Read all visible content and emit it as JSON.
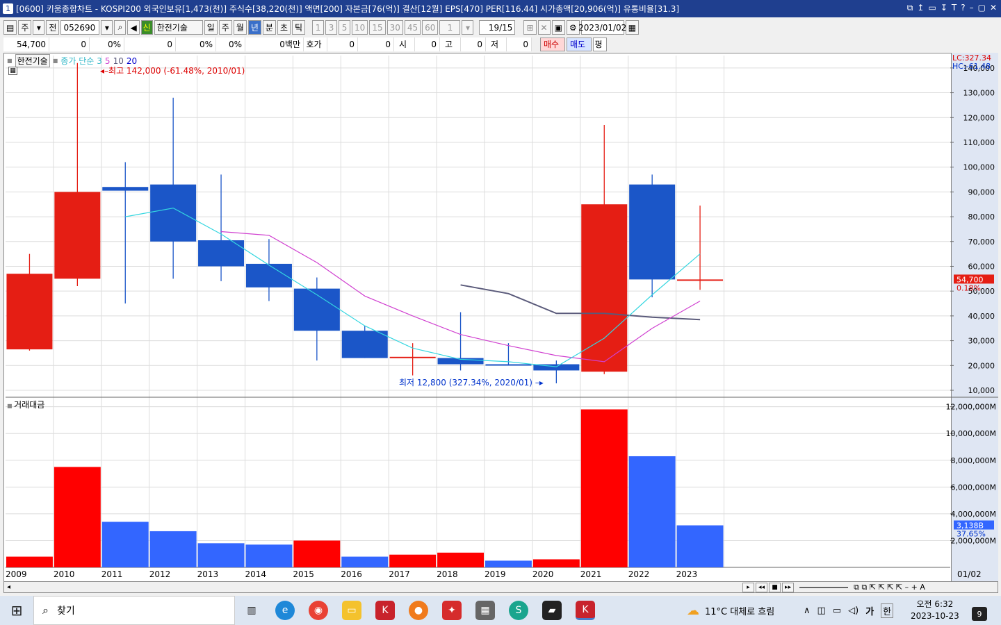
{
  "window": {
    "number": "1",
    "title": "[0600] 키움종합차트 - KOSPI200 외국인보유[1,473(천)] 주식수[38,220(천)] 액면[200] 자본금[76(억)] 결산[12월] EPS[470] PER[116.44] 시가총액[20,906(억)] 유통비율[31.3]",
    "controls": [
      "⧉",
      "↥",
      "▭",
      "↧",
      "T",
      "?",
      "–",
      "▢",
      "✕"
    ]
  },
  "toolbar": {
    "market": "주",
    "whole": "전",
    "code": "052690",
    "stock_name": "한전기술",
    "stock_badge": "신",
    "periods": [
      "일",
      "주",
      "월",
      "년",
      "분",
      "초",
      "틱"
    ],
    "selected_period": "년",
    "intervals": [
      "1",
      "3",
      "5",
      "10",
      "15",
      "30",
      "45",
      "60"
    ],
    "count": "1",
    "page": "19/15",
    "date": "2023/01/02"
  },
  "infobar": {
    "price": "54,700",
    "change": "0",
    "change_pct": "0%",
    "volume": "0",
    "volume_pct": "0%",
    "amount": "0%",
    "unit": "0백만",
    "quote_label": "호가",
    "quote_v1": "0",
    "quote_v2": "0",
    "open_label": "시",
    "open_v": "0",
    "high_label": "고",
    "high_v": "0",
    "low_label": "저",
    "low_v": "0",
    "buy": "매수",
    "sell": "매도",
    "eval": "평"
  },
  "price_panel": {
    "stock_label": "한전기술",
    "ma_label": "종가 단순",
    "ma_periods": [
      "3",
      "5",
      "10",
      "20"
    ],
    "high_annotation": "최고 142,000 (-61.48%, 2010/01)",
    "low_annotation": "최저 12,800 (327.34%, 2020/01)",
    "lc": "LC:327.34",
    "hc": "HC:-61.48",
    "current_price_tag": "54,700",
    "current_pct_tag": "0.18%",
    "y_ticks": [
      "140,000",
      "130,000",
      "120,000",
      "110,000",
      "100,000",
      "90,000",
      "80,000",
      "70,000",
      "60,000",
      "50,000",
      "40,000",
      "30,000",
      "20,000",
      "10,000"
    ]
  },
  "volume_panel": {
    "label": "거래대금",
    "current_tag": "3,138B",
    "current_pct": "37.65%",
    "y_ticks": [
      "12,000,000M",
      "10,000,000M",
      "8,000,000M",
      "6,000,000M",
      "4,000,000M",
      "2,000,000M"
    ]
  },
  "x_axis": {
    "labels": [
      "2009",
      "2010",
      "2011",
      "2012",
      "2013",
      "2014",
      "2015",
      "2016",
      "2017",
      "2018",
      "2019",
      "2020",
      "2021",
      "2022",
      "2023"
    ],
    "right_label": "01/02"
  },
  "colors": {
    "up": "#e51e14",
    "down": "#1b56c8",
    "vol_up": "#ff0000",
    "vol_down": "#3366ff",
    "ma3": "#33d6e0",
    "ma5": "#d040d0",
    "ma10": "#5a5a7a"
  },
  "chart_data": [
    {
      "type": "candlestick",
      "title": "한전기술",
      "x": [
        "2009",
        "2010",
        "2011",
        "2012",
        "2013",
        "2014",
        "2015",
        "2016",
        "2017",
        "2018",
        "2019",
        "2020",
        "2021",
        "2022",
        "2023"
      ],
      "ohlc": [
        [
          26500,
          65000,
          26000,
          57000
        ],
        [
          55000,
          142000,
          52000,
          90000
        ],
        [
          92000,
          102000,
          45000,
          90500
        ],
        [
          93000,
          128000,
          55000,
          70000
        ],
        [
          70500,
          97000,
          54000,
          60000
        ],
        [
          61000,
          71000,
          46000,
          51500
        ],
        [
          51000,
          55500,
          22000,
          34000
        ],
        [
          34000,
          36000,
          23000,
          23000
        ],
        [
          23500,
          29000,
          16000,
          23500
        ],
        [
          23000,
          41500,
          18000,
          20500
        ],
        [
          20500,
          29000,
          20000,
          20000
        ],
        [
          20500,
          22000,
          12800,
          18000
        ],
        [
          17500,
          117000,
          16500,
          85000
        ],
        [
          93000,
          97000,
          47500,
          54700
        ],
        [
          54700,
          84500,
          50500,
          54700
        ]
      ],
      "ma3": [
        null,
        null,
        80000,
        83500,
        73000,
        60500,
        48500,
        36000,
        27000,
        22500,
        21500,
        19500,
        31000,
        48500,
        65000
      ],
      "ma5": [
        null,
        null,
        null,
        null,
        74000,
        72500,
        61500,
        48000,
        40000,
        32500,
        28000,
        24000,
        21500,
        35000,
        46000
      ],
      "ma10": [
        null,
        null,
        null,
        null,
        null,
        null,
        null,
        null,
        null,
        52500,
        49000,
        41000,
        41000,
        39500,
        38500
      ],
      "ylim": [
        10000,
        145000
      ]
    },
    {
      "type": "bar",
      "title": "거래대금",
      "x": [
        "2009",
        "2010",
        "2011",
        "2012",
        "2013",
        "2014",
        "2015",
        "2016",
        "2017",
        "2018",
        "2019",
        "2020",
        "2021",
        "2022",
        "2023"
      ],
      "values": [
        800000,
        7500000,
        3400000,
        2700000,
        1800000,
        1700000,
        2000000,
        800000,
        950000,
        1100000,
        500000,
        600000,
        11800000,
        8300000,
        3138000
      ],
      "up": [
        true,
        true,
        false,
        false,
        false,
        false,
        true,
        false,
        true,
        true,
        false,
        true,
        true,
        false,
        false
      ],
      "ylabel": "거래대금",
      "ylim": [
        0,
        12500000
      ]
    }
  ],
  "taskbar": {
    "search_label": "찾기",
    "weather": "11°C 대체로 흐림",
    "ime1": "가",
    "ime2": "한",
    "time": "오전 6:32",
    "date": "2023-10-23",
    "notifications": "9"
  }
}
